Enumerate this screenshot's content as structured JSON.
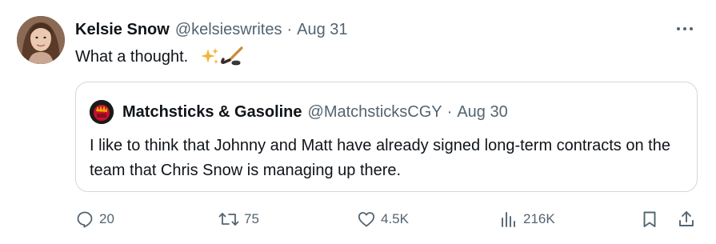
{
  "author": {
    "display_name": "Kelsie Snow",
    "handle": "@kelsieswrites",
    "separator": "·",
    "date": "Aug 31",
    "avatar_icon": "profile-photo"
  },
  "tweet": {
    "text": "What a thought.",
    "emojis": [
      "sparkles-icon",
      "hockey-stick-icon"
    ]
  },
  "quote": {
    "display_name": "Matchsticks & Gasoline",
    "handle": "@MatchsticksCGY",
    "separator": "·",
    "date": "Aug 30",
    "text": "I like to think that Johnny and Matt have already signed long-term contracts on the team that Chris Snow is managing up there."
  },
  "actions": {
    "replies": "20",
    "retweets": "75",
    "likes": "4.5K",
    "views": "216K"
  },
  "colors": {
    "text": "#0f1419",
    "muted": "#536471",
    "border": "#cfd9de"
  }
}
